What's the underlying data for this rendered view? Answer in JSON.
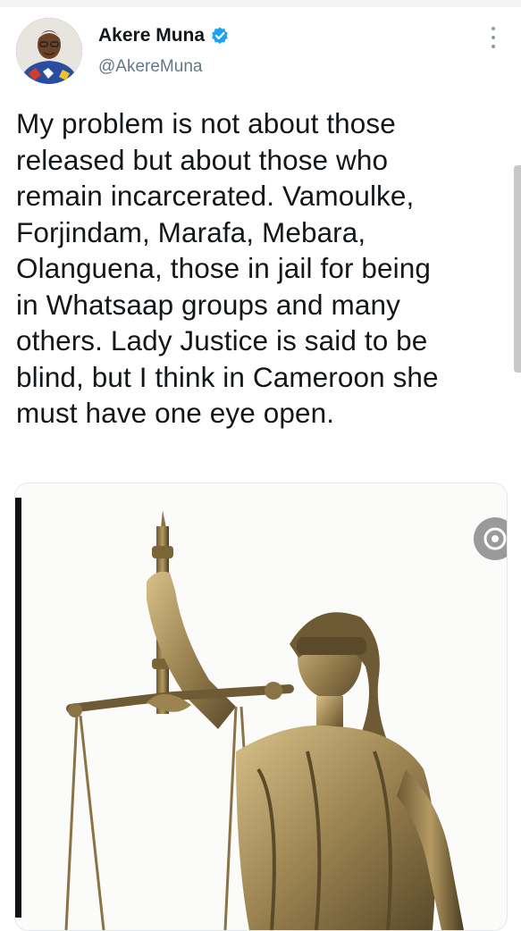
{
  "author": {
    "display_name": "Akere Muna",
    "handle": "@AkereMuna",
    "verified": true,
    "avatar_icon": "person-portrait-icon"
  },
  "tweet": {
    "text": "My problem is not about those\nreleased but about those who\nremain incarcerated. Vamoulke,\nForjindam, Marafa, Mebara,\nOlanguena, those in jail for being\nin Whatsaap groups and many\nothers. Lady Justice is said to be\nblind, but I think in Cameroon she\nmust have one eye open."
  },
  "media": {
    "subject": "lady-justice-statue",
    "badge_icon": "camera-lens-icon"
  },
  "colors": {
    "verified_blue": "#1da1f2",
    "handle_gray": "#657786",
    "text": "#14171a",
    "bronze": "#9c8452"
  }
}
